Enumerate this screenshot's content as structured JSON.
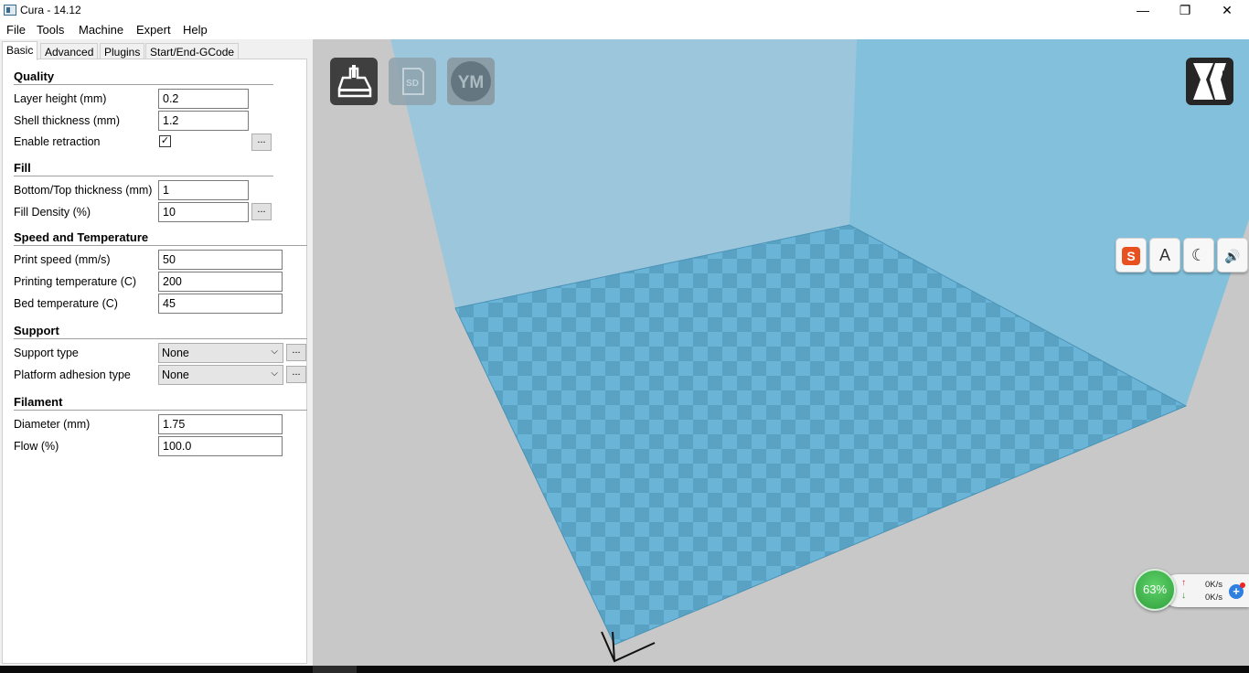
{
  "window": {
    "title": "Cura - 14.12",
    "min": "—",
    "max": "❐",
    "close": "✕"
  },
  "menu": [
    "File",
    "Tools",
    "Machine",
    "Expert",
    "Help"
  ],
  "tabs": [
    "Basic",
    "Advanced",
    "Plugins",
    "Start/End-GCode"
  ],
  "quality": {
    "title": "Quality",
    "layer_height_label": "Layer height (mm)",
    "layer_height": "0.2",
    "shell_thickness_label": "Shell thickness (mm)",
    "shell_thickness": "1.2",
    "enable_retraction_label": "Enable retraction",
    "enable_retraction_checked": true
  },
  "fill": {
    "title": "Fill",
    "bottom_top_label": "Bottom/Top thickness (mm)",
    "bottom_top": "1",
    "density_label": "Fill Density (%)",
    "density": "10"
  },
  "speed": {
    "title": "Speed and Temperature",
    "print_speed_label": "Print speed (mm/s)",
    "print_speed": "50",
    "print_temp_label": "Printing temperature (C)",
    "print_temp": "200",
    "bed_temp_label": "Bed temperature (C)",
    "bed_temp": "45"
  },
  "support": {
    "title": "Support",
    "type_label": "Support type",
    "type": "None",
    "adhesion_label": "Platform adhesion type",
    "adhesion": "None"
  },
  "filament": {
    "title": "Filament",
    "diameter_label": "Diameter (mm)",
    "diameter": "1.75",
    "flow_label": "Flow (%)",
    "flow": "100.0"
  },
  "dots_label": "...",
  "toolbar": {
    "load_icon": "load-model-icon",
    "sd_label": "SD",
    "ym_label": "YM",
    "view_icon": "view-mode-icon"
  },
  "ime": {
    "logo": "S",
    "letter": "A",
    "moon": "☾",
    "speaker": "🔊"
  },
  "network": {
    "percent": "63%",
    "up": "0K/s",
    "down": "0K/s",
    "up_arrow": "↑",
    "down_arrow": "↓",
    "plus": "+"
  },
  "colors": {
    "bed": "#6ab4d8",
    "bed_alt": "#5aa2c4",
    "wall": "#9cc8e0",
    "viewport_bg": "#c8c8c8"
  }
}
